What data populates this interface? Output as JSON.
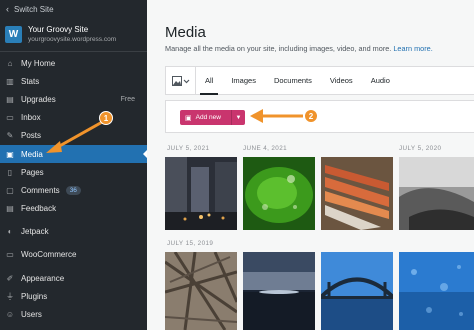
{
  "sidebar": {
    "switch_site": "Switch Site",
    "site_name": "Your Groovy Site",
    "site_url": "yourgroovysite.wordpress.com",
    "items": [
      {
        "label": "My Home",
        "icon": "home-icon"
      },
      {
        "label": "Stats",
        "icon": "stats-icon"
      },
      {
        "label": "Upgrades",
        "icon": "upgrades-icon",
        "extra": "Free"
      },
      {
        "label": "Inbox",
        "icon": "inbox-icon"
      },
      {
        "label": "Posts",
        "icon": "posts-icon"
      },
      {
        "label": "Media",
        "icon": "media-icon",
        "active": true
      },
      {
        "label": "Pages",
        "icon": "pages-icon"
      },
      {
        "label": "Comments",
        "icon": "comments-icon",
        "badge": "36"
      },
      {
        "label": "Feedback",
        "icon": "feedback-icon"
      },
      {
        "label": "Jetpack",
        "icon": "jetpack-icon"
      },
      {
        "label": "WooCommerce",
        "icon": "woocommerce-icon"
      },
      {
        "label": "Appearance",
        "icon": "appearance-icon"
      },
      {
        "label": "Plugins",
        "icon": "plugins-icon"
      },
      {
        "label": "Users",
        "icon": "users-icon"
      }
    ]
  },
  "main": {
    "title": "Media",
    "description": "Manage all the media on your site, including images, video, and more.",
    "learn_more": "Learn more.",
    "tabs": [
      "All",
      "Images",
      "Documents",
      "Videos",
      "Audio"
    ],
    "add_new": "Add new",
    "date_groups": [
      "JULY 5, 2021",
      "JUNE 4, 2021",
      "JULY 5, 2020",
      "JULY 15, 2019"
    ]
  },
  "callouts": [
    "1",
    "2"
  ],
  "colors": {
    "sidebar_bg": "#23282d",
    "active_blue": "#2271b1",
    "add_new_pink": "#c9356e",
    "callout_orange": "#f0932b"
  }
}
